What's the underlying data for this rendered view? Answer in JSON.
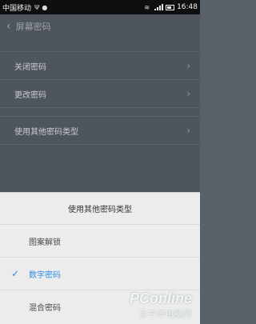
{
  "status_bar": {
    "carrier": "中国移动",
    "time": "16:48",
    "icons": [
      "usb-icon",
      "notification-icon",
      "wifi-icon",
      "signal-icon",
      "battery-icon"
    ]
  },
  "settings": {
    "title": "屏幕密码",
    "items": [
      {
        "label": "关闭密码"
      },
      {
        "label": "更改密码"
      },
      {
        "label": "使用其他密码类型"
      }
    ]
  },
  "dialog": {
    "title": "使用其他密码类型",
    "options": [
      {
        "label": "图案解锁",
        "selected": false
      },
      {
        "label": "数字密码",
        "selected": true
      },
      {
        "label": "混合密码",
        "selected": false
      }
    ],
    "accent_color": "#2e8de6"
  },
  "watermark": {
    "brand": "PConline",
    "subtitle": "太平洋电脑网"
  }
}
